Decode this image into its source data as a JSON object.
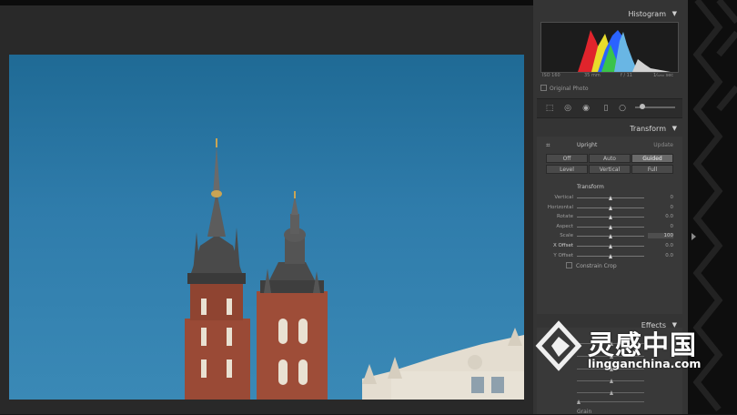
{
  "histogram": {
    "title": "Histogram",
    "iso": "ISO 160",
    "focal": "35 mm",
    "aperture": "f / 11",
    "shutter": "1⁄₁₂₅₀ sec",
    "original_photo_label": "Original Photo"
  },
  "transform": {
    "title": "Transform",
    "upright_label": "Upright",
    "update_label": "Update",
    "upright_buttons": [
      {
        "label": "Off",
        "active": false
      },
      {
        "label": "Auto",
        "active": false
      },
      {
        "label": "Guided",
        "active": true
      }
    ],
    "upright_buttons_row2": [
      {
        "label": "Level",
        "active": false
      },
      {
        "label": "Vertical",
        "active": false
      },
      {
        "label": "Full",
        "active": false
      }
    ],
    "section_label": "Transform",
    "sliders": [
      {
        "label": "Vertical",
        "value": "0",
        "pos": 0.5
      },
      {
        "label": "Horizontal",
        "value": "0",
        "pos": 0.5
      },
      {
        "label": "Rotate",
        "value": "0.0",
        "pos": 0.5
      },
      {
        "label": "Aspect",
        "value": "0",
        "pos": 0.5
      },
      {
        "label": "Scale",
        "value": "100",
        "pos": 0.5
      },
      {
        "label": "X Offset",
        "value": "0.0",
        "pos": 0.5
      },
      {
        "label": "Y Offset",
        "value": "0.0",
        "pos": 0.5
      }
    ],
    "constrain_crop_label": "Constrain Crop"
  },
  "effects": {
    "title": "Effects",
    "grain_label": "Grain"
  },
  "watermark": {
    "cn": "灵感中国",
    "url": "lingganchina.com"
  },
  "colors": {
    "panel_bg": "#343434",
    "workspace_bg": "#292929",
    "sky": "#2f7cab"
  }
}
